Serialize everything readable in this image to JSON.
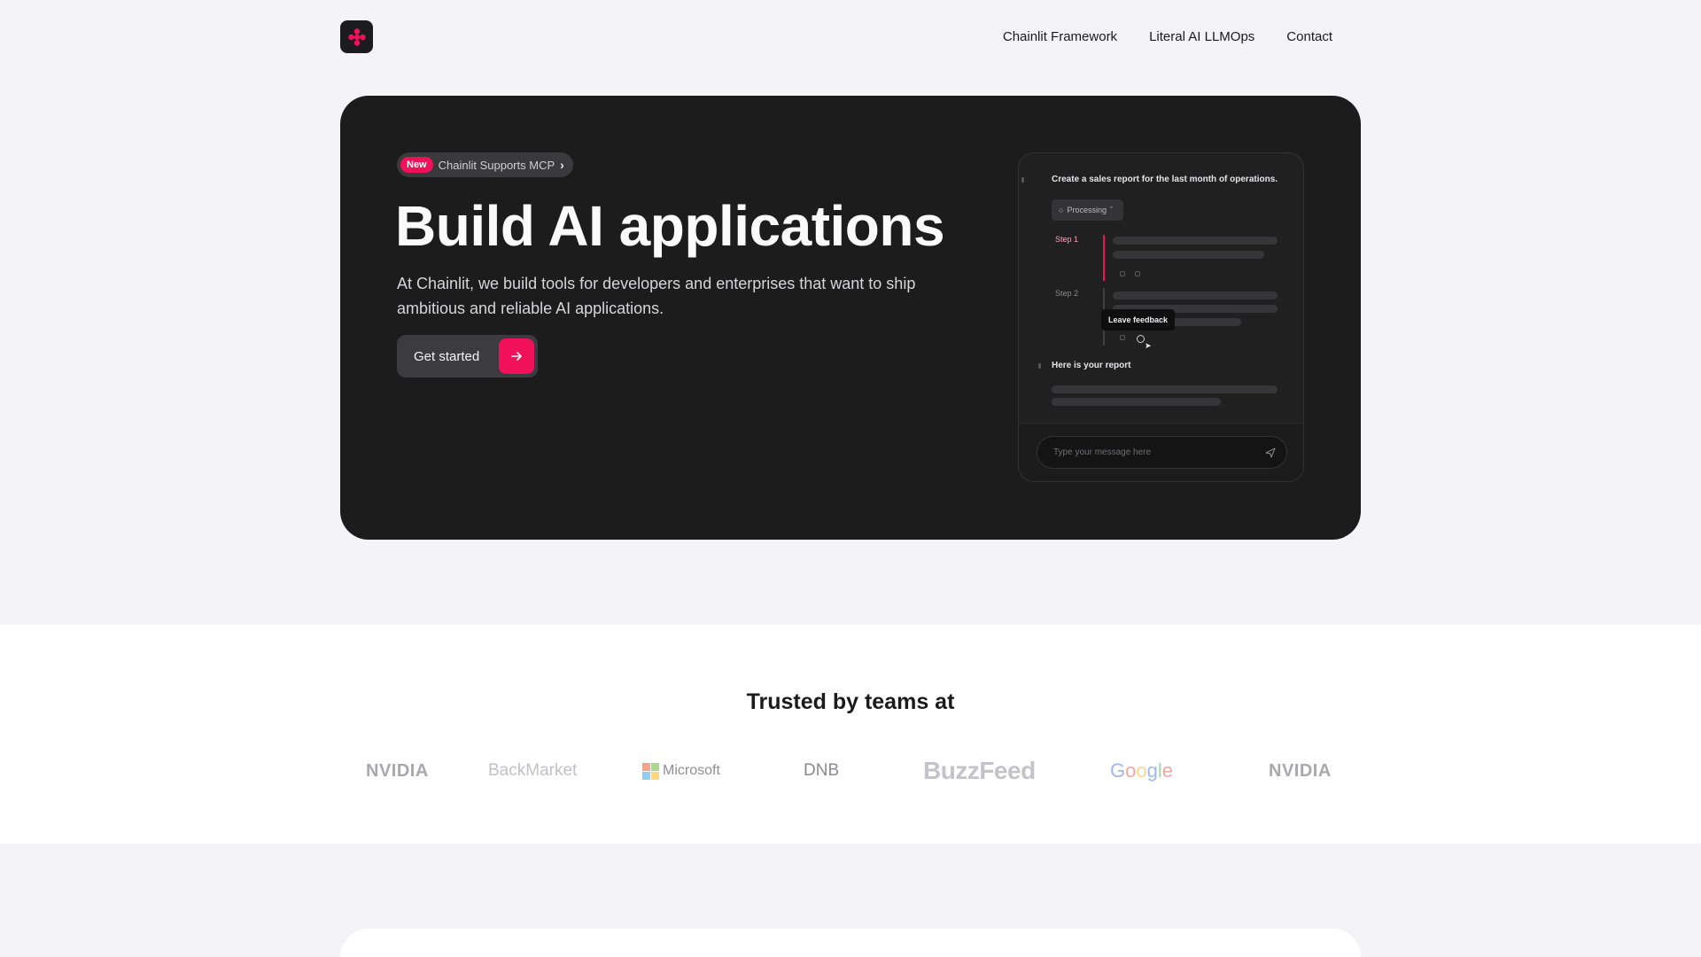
{
  "nav": {
    "links": [
      "Chainlit Framework",
      "Literal AI LLMOps",
      "Contact"
    ]
  },
  "hero": {
    "badge_new": "New",
    "badge_text": "Chainlit Supports MCP",
    "title": "Build AI applications",
    "subtitle": "At Chainlit, we build tools for developers and enterprises that want to ship ambitious and reliable AI applications.",
    "cta_label": "Get started"
  },
  "chat_preview": {
    "question": "Create a sales report for the last month of operations.",
    "processing_label": "Processing",
    "step1_label": "Step 1",
    "step2_label": "Step 2",
    "tooltip": "Leave feedback",
    "response": "Here is your report",
    "input_placeholder": "Type your message here"
  },
  "trusted": {
    "title": "Trusted by teams at",
    "logos": [
      "NVIDIA",
      "BackMarket",
      "Microsoft",
      "DNB",
      "BuzzFeed",
      "Google",
      "NVIDIA"
    ]
  },
  "colors": {
    "accent": "#f0115a",
    "hero_bg": "#1c1c1c",
    "page_bg": "#f4f4f6"
  },
  "icons": [
    "chainlit-logo-icon",
    "chevron-right-icon",
    "arrow-right-icon",
    "processing-icon",
    "feedback-icon",
    "send-icon"
  ]
}
